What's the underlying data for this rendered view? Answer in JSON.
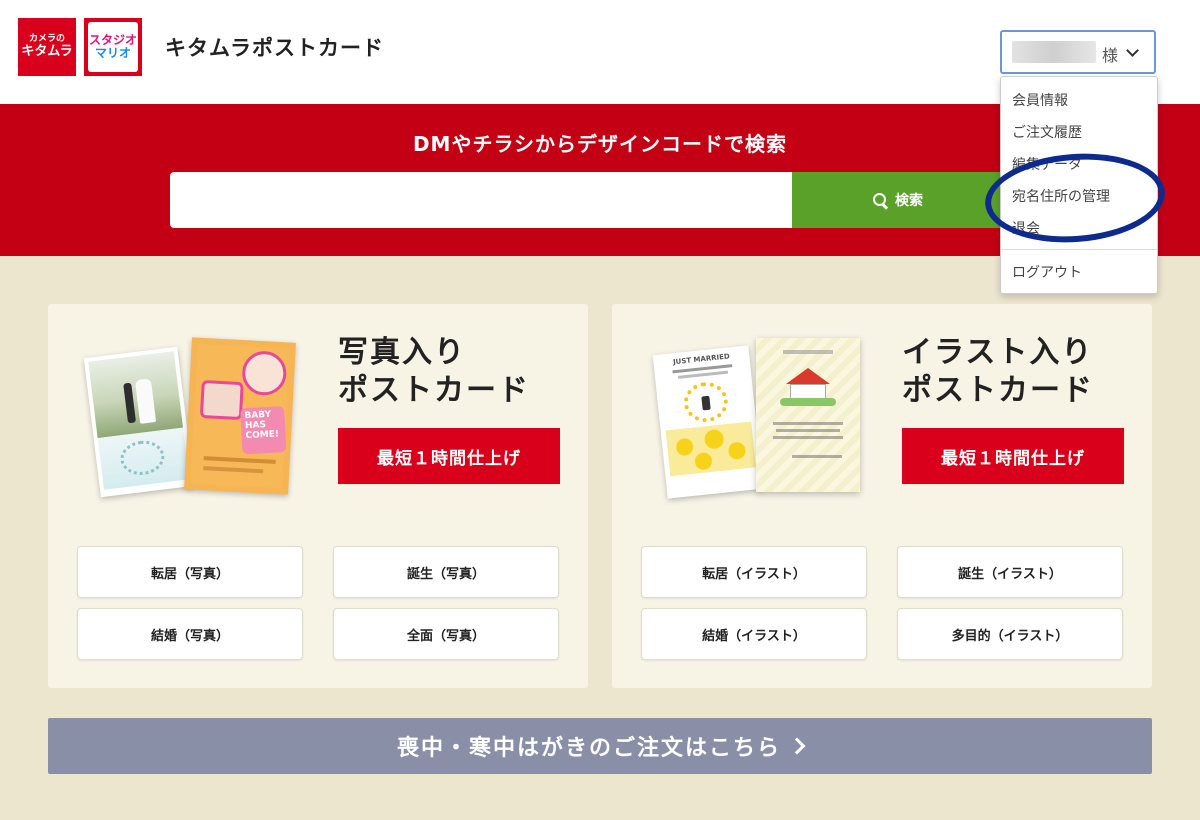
{
  "header": {
    "logo_kitamura_small": "カメラの",
    "logo_kitamura_big": "キタムラ",
    "logo_studio_line1": "スタジオ",
    "logo_studio_line2": "マリオ",
    "site_title": "キタムラポストカード",
    "user_suffix": "様"
  },
  "user_menu": {
    "items": [
      "会員情報",
      "ご注文履歴",
      "編集データ",
      "宛名住所の管理",
      "退会"
    ],
    "logout": "ログアウト"
  },
  "search": {
    "title": "DMやチラシからデザインコードで検索",
    "value": "",
    "button_label": "検索"
  },
  "panels": {
    "photo": {
      "title_line1": "写真入り",
      "title_line2": "ポストカード",
      "cta_label": "最短１時間仕上げ",
      "categories": [
        "転居（写真）",
        "誕生（写真）",
        "結婚（写真）",
        "全面（写真）"
      ]
    },
    "illust": {
      "title_line1": "イラスト入り",
      "title_line2": "ポストカード",
      "cta_label": "最短１時間仕上げ",
      "categories": [
        "転居（イラスト）",
        "誕生（イラスト）",
        "結婚（イラスト）",
        "多目的（イラスト）"
      ]
    }
  },
  "thumbnails": {
    "baby_card_text": "BABY HAS COME!",
    "wedding_card_text": "JUST MARRIED"
  },
  "mourning": {
    "label": "喪中・寒中はがきのご注文はこちら"
  },
  "colors": {
    "brand_red": "#c30014",
    "search_green": "#5aa12a",
    "page_bg": "#ede6cf",
    "mourning_gray": "#8a8fa8",
    "annotation_blue": "#0d2b8c"
  }
}
